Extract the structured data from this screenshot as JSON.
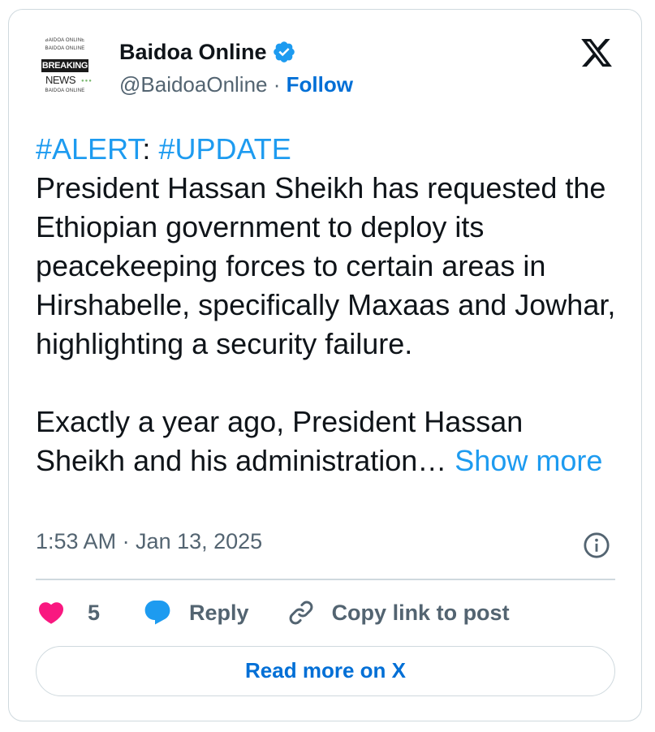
{
  "author": {
    "name": "Baidoa Online",
    "handle": "@BaidoaOnline",
    "separator": "·",
    "follow_label": "Follow",
    "avatar_text": {
      "line1": "BAIDOA ONLINE",
      "line2": "BAIDOA ONLINE",
      "breaking": "BREAKING",
      "news": "NEWS",
      "bottom": "BAIDOA ONLINE"
    }
  },
  "post": {
    "hashtag1": "#ALERT",
    "colon": ": ",
    "hashtag2": "#UPDATE",
    "paragraph1": "President Hassan Sheikh has requested the Ethiopian government to deploy its peacekeeping forces to certain areas in Hirshabelle, specifically Maxaas and Jowhar, highlighting a security failure.",
    "paragraph2": "Exactly a year ago, President Hassan Sheikh and his administration…",
    "show_more": "Show more",
    "timestamp": "1:53 AM · Jan 13, 2025"
  },
  "actions": {
    "likes_count": "5",
    "reply_label": "Reply",
    "copy_link_label": "Copy link to post"
  },
  "read_more_label": "Read more on X",
  "colors": {
    "link": "#1d9bf0",
    "follow": "#006fd6",
    "heart": "#f91880",
    "verified": "#1d9bf0",
    "secondary_text": "#536471"
  },
  "icons": [
    "verified-badge-icon",
    "x-logo-icon",
    "info-icon",
    "heart-icon",
    "reply-bubble-icon",
    "link-icon"
  ]
}
